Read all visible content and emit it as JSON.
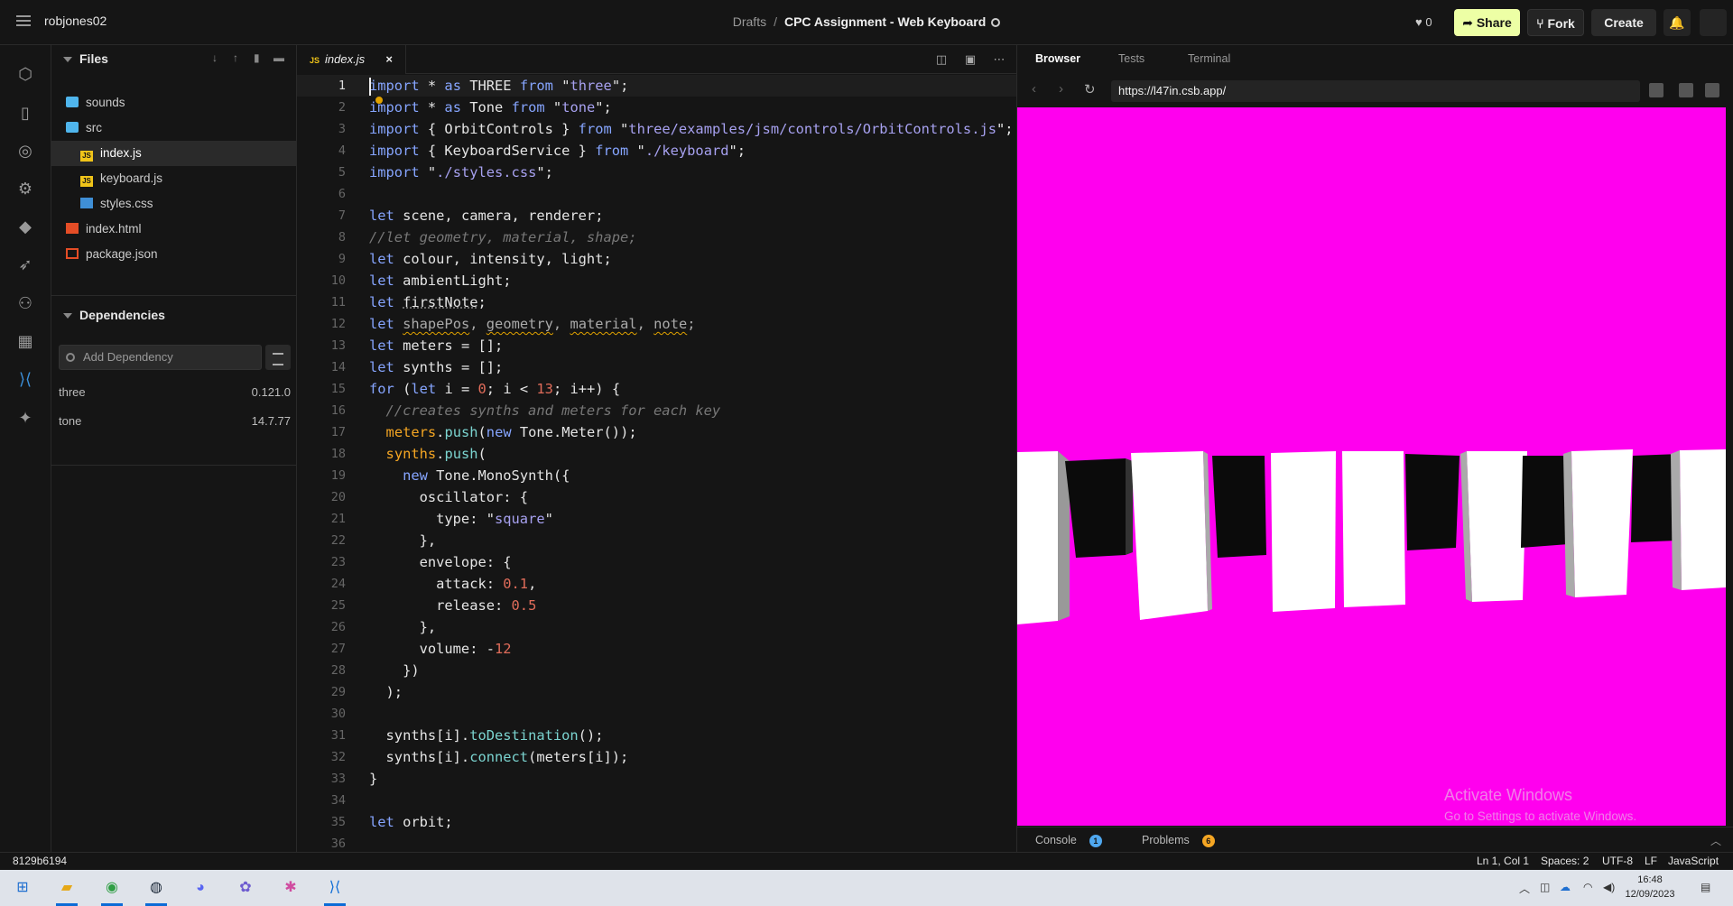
{
  "topbar": {
    "user": "robjones02",
    "drafts": "Drafts",
    "sep": "/",
    "title": "CPC Assignment - Web Keyboard",
    "likes": "♥ 0",
    "share": "Share",
    "fork": "Fork",
    "create": "Create"
  },
  "files": {
    "header": "Files",
    "items": [
      {
        "label": "sounds",
        "type": "folder"
      },
      {
        "label": "src",
        "type": "folder"
      },
      {
        "label": "index.js",
        "type": "js",
        "selected": true
      },
      {
        "label": "keyboard.js",
        "type": "js"
      },
      {
        "label": "styles.css",
        "type": "css"
      },
      {
        "label": "index.html",
        "type": "html"
      },
      {
        "label": "package.json",
        "type": "json"
      }
    ]
  },
  "deps": {
    "header": "Dependencies",
    "placeholder": "Add Dependency",
    "items": [
      {
        "name": "three",
        "version": "0.121.0"
      },
      {
        "name": "tone",
        "version": "14.7.77"
      }
    ]
  },
  "editor": {
    "tab": "index.js",
    "tab_badge": "JS",
    "close": "×",
    "lines": [
      "1",
      "2",
      "3",
      "4",
      "5",
      "6",
      "7",
      "8",
      "9",
      "10",
      "11",
      "12",
      "13",
      "14",
      "15",
      "16",
      "17",
      "18",
      "19",
      "20",
      "21",
      "22",
      "23",
      "24",
      "25",
      "26",
      "27",
      "28",
      "29",
      "30",
      "31",
      "32",
      "33",
      "34",
      "35",
      "36"
    ]
  },
  "panel": {
    "tabs": [
      "Browser",
      "Tests",
      "Terminal"
    ],
    "url": "https://l47in.csb.app/",
    "bg": "#ff00ee",
    "watermark_title": "Activate Windows",
    "watermark_sub": "Go to Settings to activate Windows.",
    "bottom_tabs": [
      {
        "label": "Console",
        "count": "1",
        "color": "#4fa8f0"
      },
      {
        "label": "Problems",
        "count": "6",
        "color": "#f5a623"
      }
    ]
  },
  "status": {
    "hash": "8129b6194",
    "pos": "Ln 1, Col 1",
    "spaces": "Spaces: 2",
    "enc": "UTF-8",
    "eol": "LF",
    "lang": "JavaScript"
  },
  "taskbar": {
    "time": "16:48",
    "date": "12/09/2023"
  }
}
